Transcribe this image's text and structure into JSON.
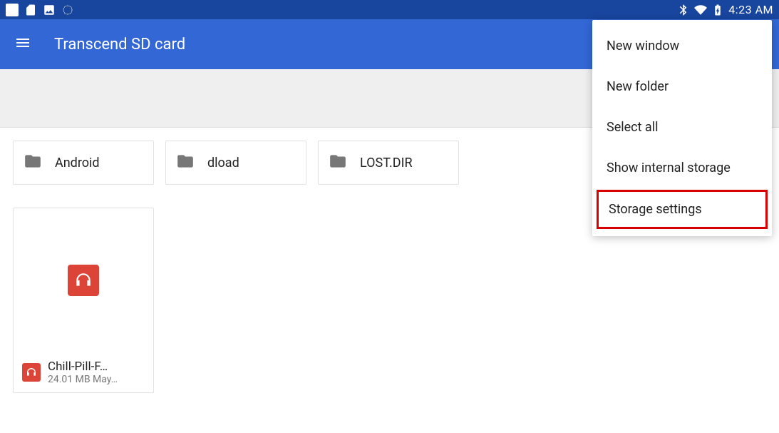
{
  "status_bar": {
    "time": "4:23 AM"
  },
  "app_bar": {
    "title": "Transcend SD card"
  },
  "folders": [
    {
      "name": "Android"
    },
    {
      "name": "dload"
    },
    {
      "name": "LOST.DIR"
    }
  ],
  "files": [
    {
      "name": "Chill-Pill-F…",
      "meta": "24.01 MB May…"
    }
  ],
  "overflow_menu": {
    "items": [
      {
        "label": "New window",
        "highlighted": false
      },
      {
        "label": "New folder",
        "highlighted": false
      },
      {
        "label": "Select all",
        "highlighted": false
      },
      {
        "label": "Show internal storage",
        "highlighted": false
      },
      {
        "label": "Storage settings",
        "highlighted": true
      }
    ]
  }
}
